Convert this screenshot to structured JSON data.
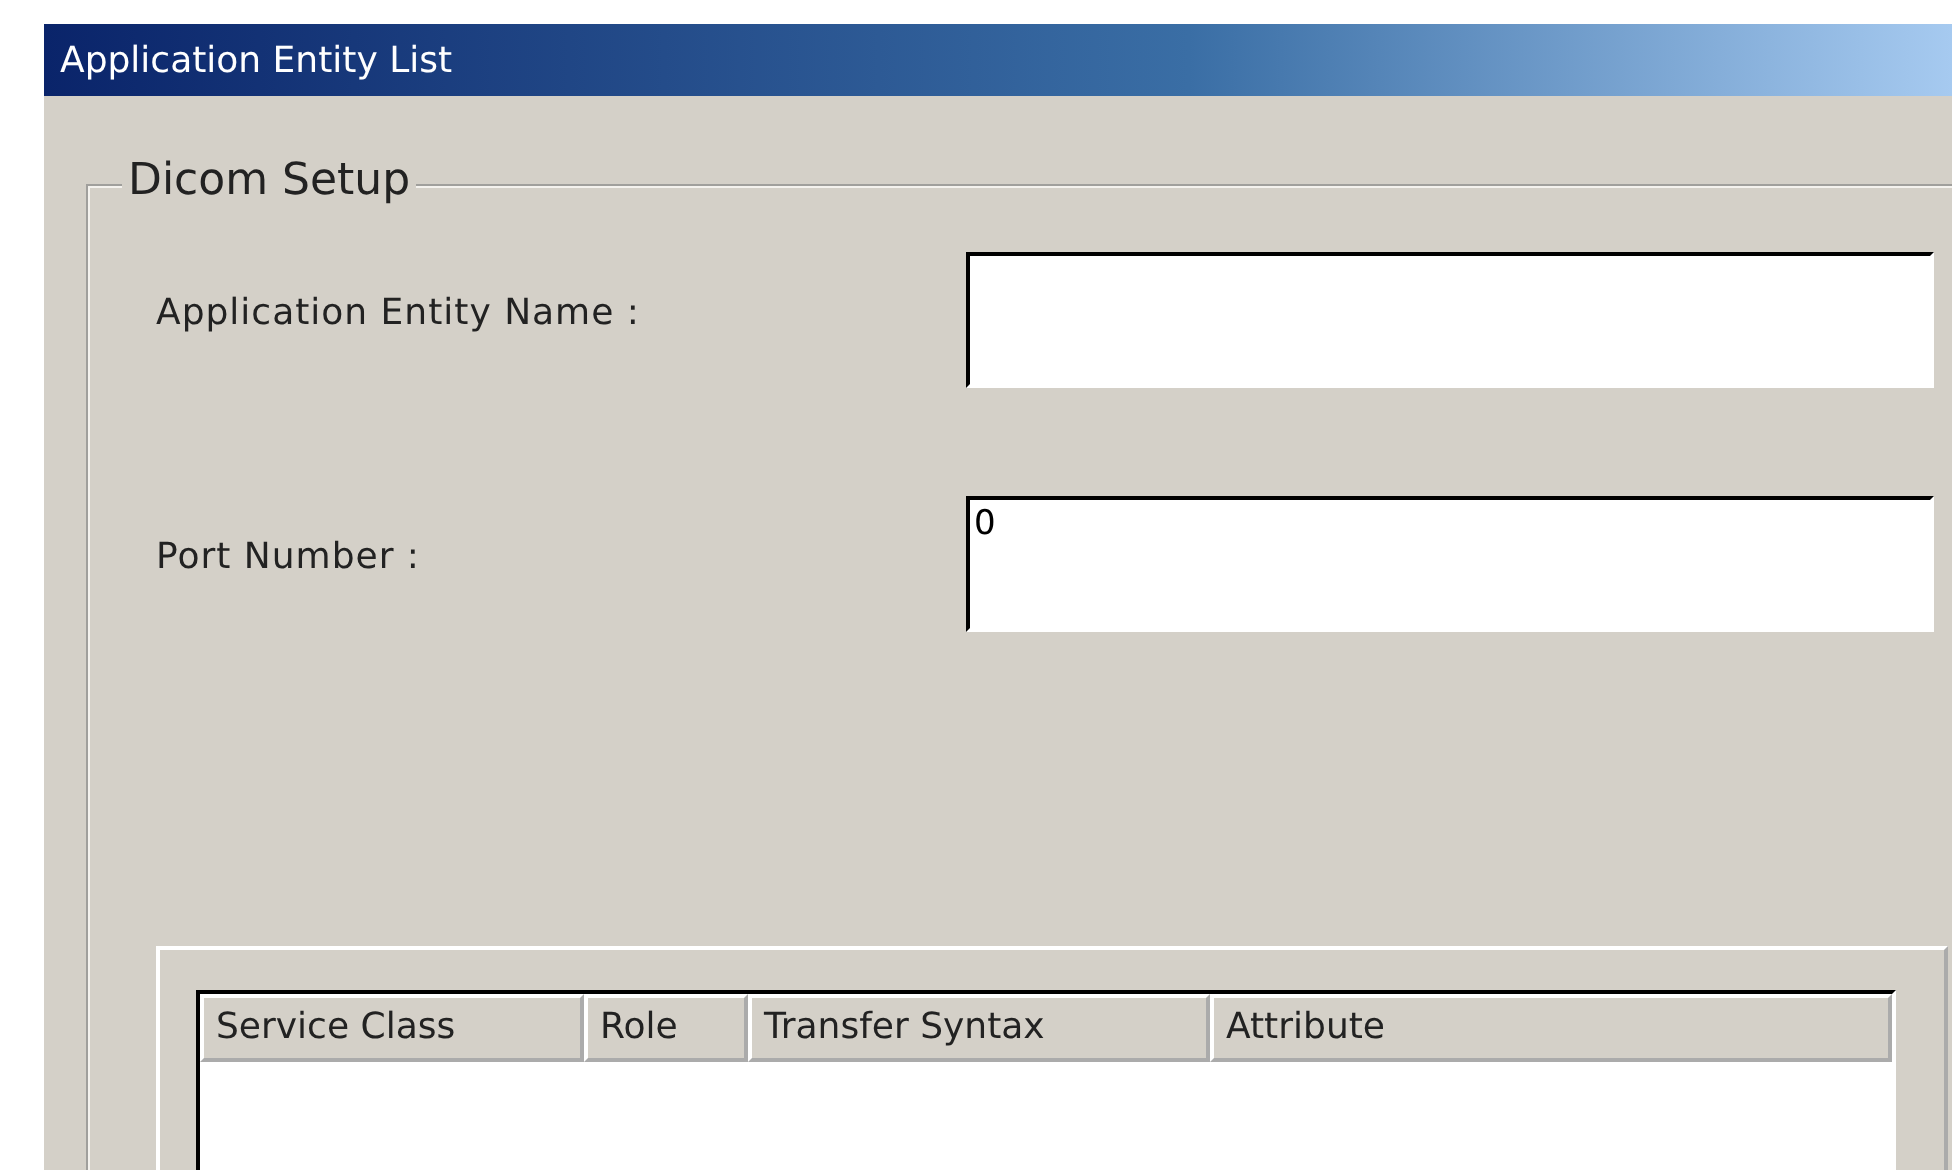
{
  "window": {
    "title": "Application Entity List"
  },
  "group": {
    "title": "Dicom Setup"
  },
  "fields": [
    {
      "label": "Application  Entity Name :"
    },
    {
      "label": "Port Number :",
      "value": "0"
    }
  ],
  "table": {
    "columns": [
      "Service Class",
      "Role",
      "Transfer Syntax",
      "Attribute"
    ]
  }
}
